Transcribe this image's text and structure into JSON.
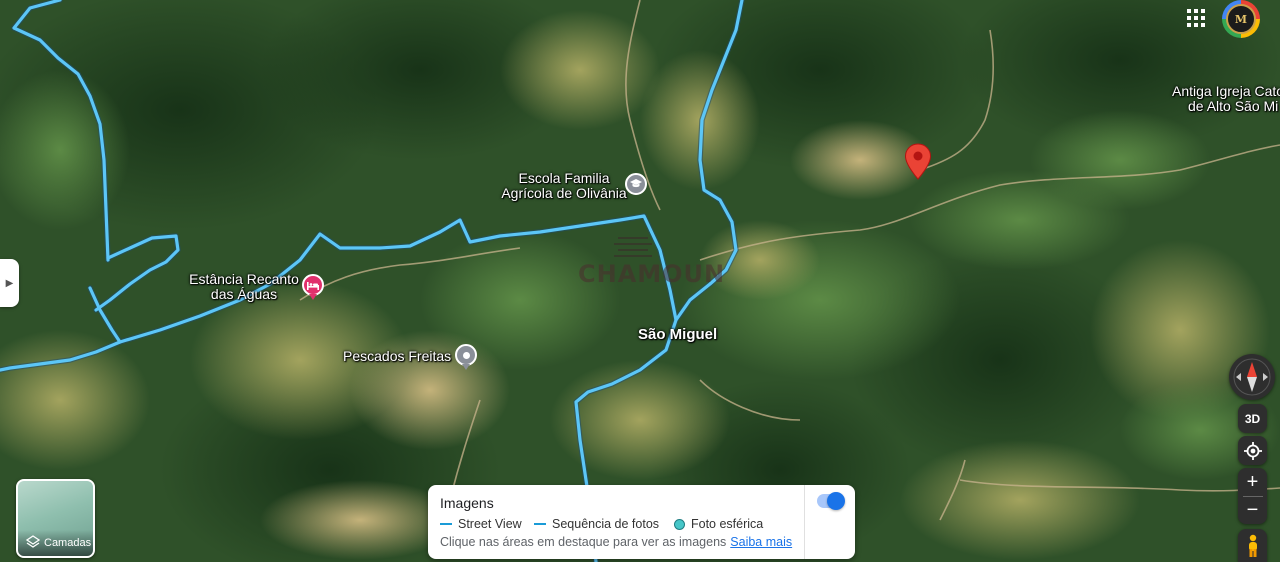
{
  "map": {
    "labels": {
      "escola_line1": "Escola Familia",
      "escola_line2": "Agrícola de Olivânia",
      "estancia_line1": "Estância Recanto",
      "estancia_line2": "das Águas",
      "pescados": "Pescados Freitas",
      "sao_miguel": "São Miguel",
      "igreja_line1": "Antiga Igreja Cato",
      "igreja_line2": "de Alto São Mi"
    },
    "watermark_text": "CHAMOUN"
  },
  "controls": {
    "three_d_label": "3D",
    "zoom_in": "+",
    "zoom_out": "−"
  },
  "layers": {
    "label": "Camadas"
  },
  "imagery_panel": {
    "title": "Imagens",
    "legend": {
      "street_view": "Street View",
      "photo_sequence": "Sequência de fotos",
      "spherical_photo": "Foto esférica"
    },
    "hint": "Clique nas áreas em destaque para ver as imagens",
    "learn_more": "Saiba mais",
    "toggle_on": true
  },
  "colors": {
    "street_view_line": "#57c3f5",
    "pin_red": "#ea4335",
    "hotel_pink": "#e1306c",
    "poi_gray": "#8a8f99",
    "accent_blue": "#1a73e8"
  },
  "icons": [
    "apps-grid-icon",
    "profile-avatar-icon",
    "hotel-icon",
    "school-icon",
    "location-pin-icon",
    "compass-icon",
    "my-location-icon",
    "pegman-icon",
    "layers-icon"
  ]
}
